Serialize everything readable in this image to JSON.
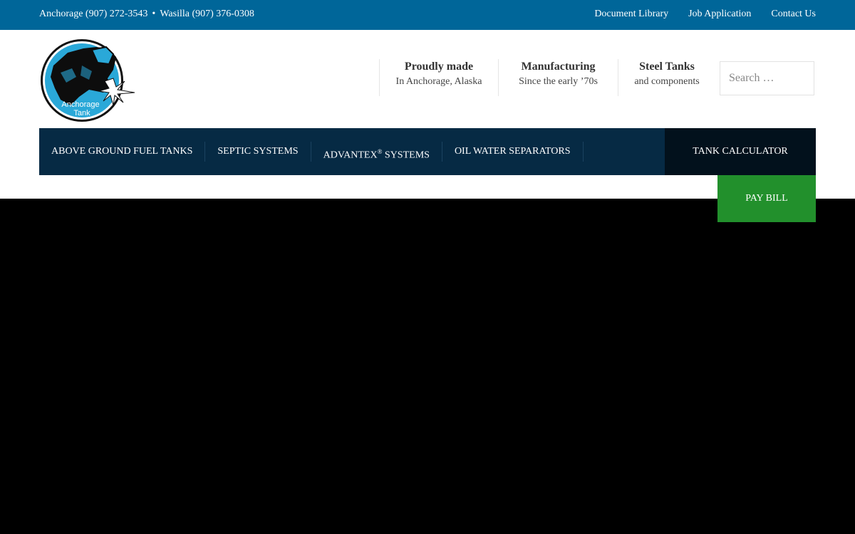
{
  "topbar": {
    "phone_anchorage": "Anchorage (907) 272-3543",
    "separator": "•",
    "phone_wasilla": "Wasilla (907) 376-0308",
    "links": [
      "Document Library",
      "Job Application",
      "Contact Us"
    ]
  },
  "logo": {
    "text_line1": "Anchorage",
    "text_line2": "Tank"
  },
  "features": [
    {
      "title": "Proudly made",
      "subtitle": "In Anchorage, Alaska"
    },
    {
      "title": "Manufacturing",
      "subtitle": "Since the early ’70s"
    },
    {
      "title": "Steel Tanks",
      "subtitle": "and components"
    }
  ],
  "search": {
    "placeholder": "Search …"
  },
  "nav": {
    "items": [
      {
        "label": "ABOVE GROUND FUEL TANKS"
      },
      {
        "label": "SEPTIC SYSTEMS"
      },
      {
        "label_pre": "ADVANTEX",
        "label_sup": "®",
        "label_post": " SYSTEMS"
      },
      {
        "label": "OIL WATER SEPARATORS"
      }
    ],
    "calculator": "TANK CALCULATOR",
    "pay_bill": "PAY BILL"
  },
  "colors": {
    "topbar": "#006699",
    "nav": "#062a44",
    "calculator": "#02111c",
    "pay_bill": "#22902c"
  }
}
